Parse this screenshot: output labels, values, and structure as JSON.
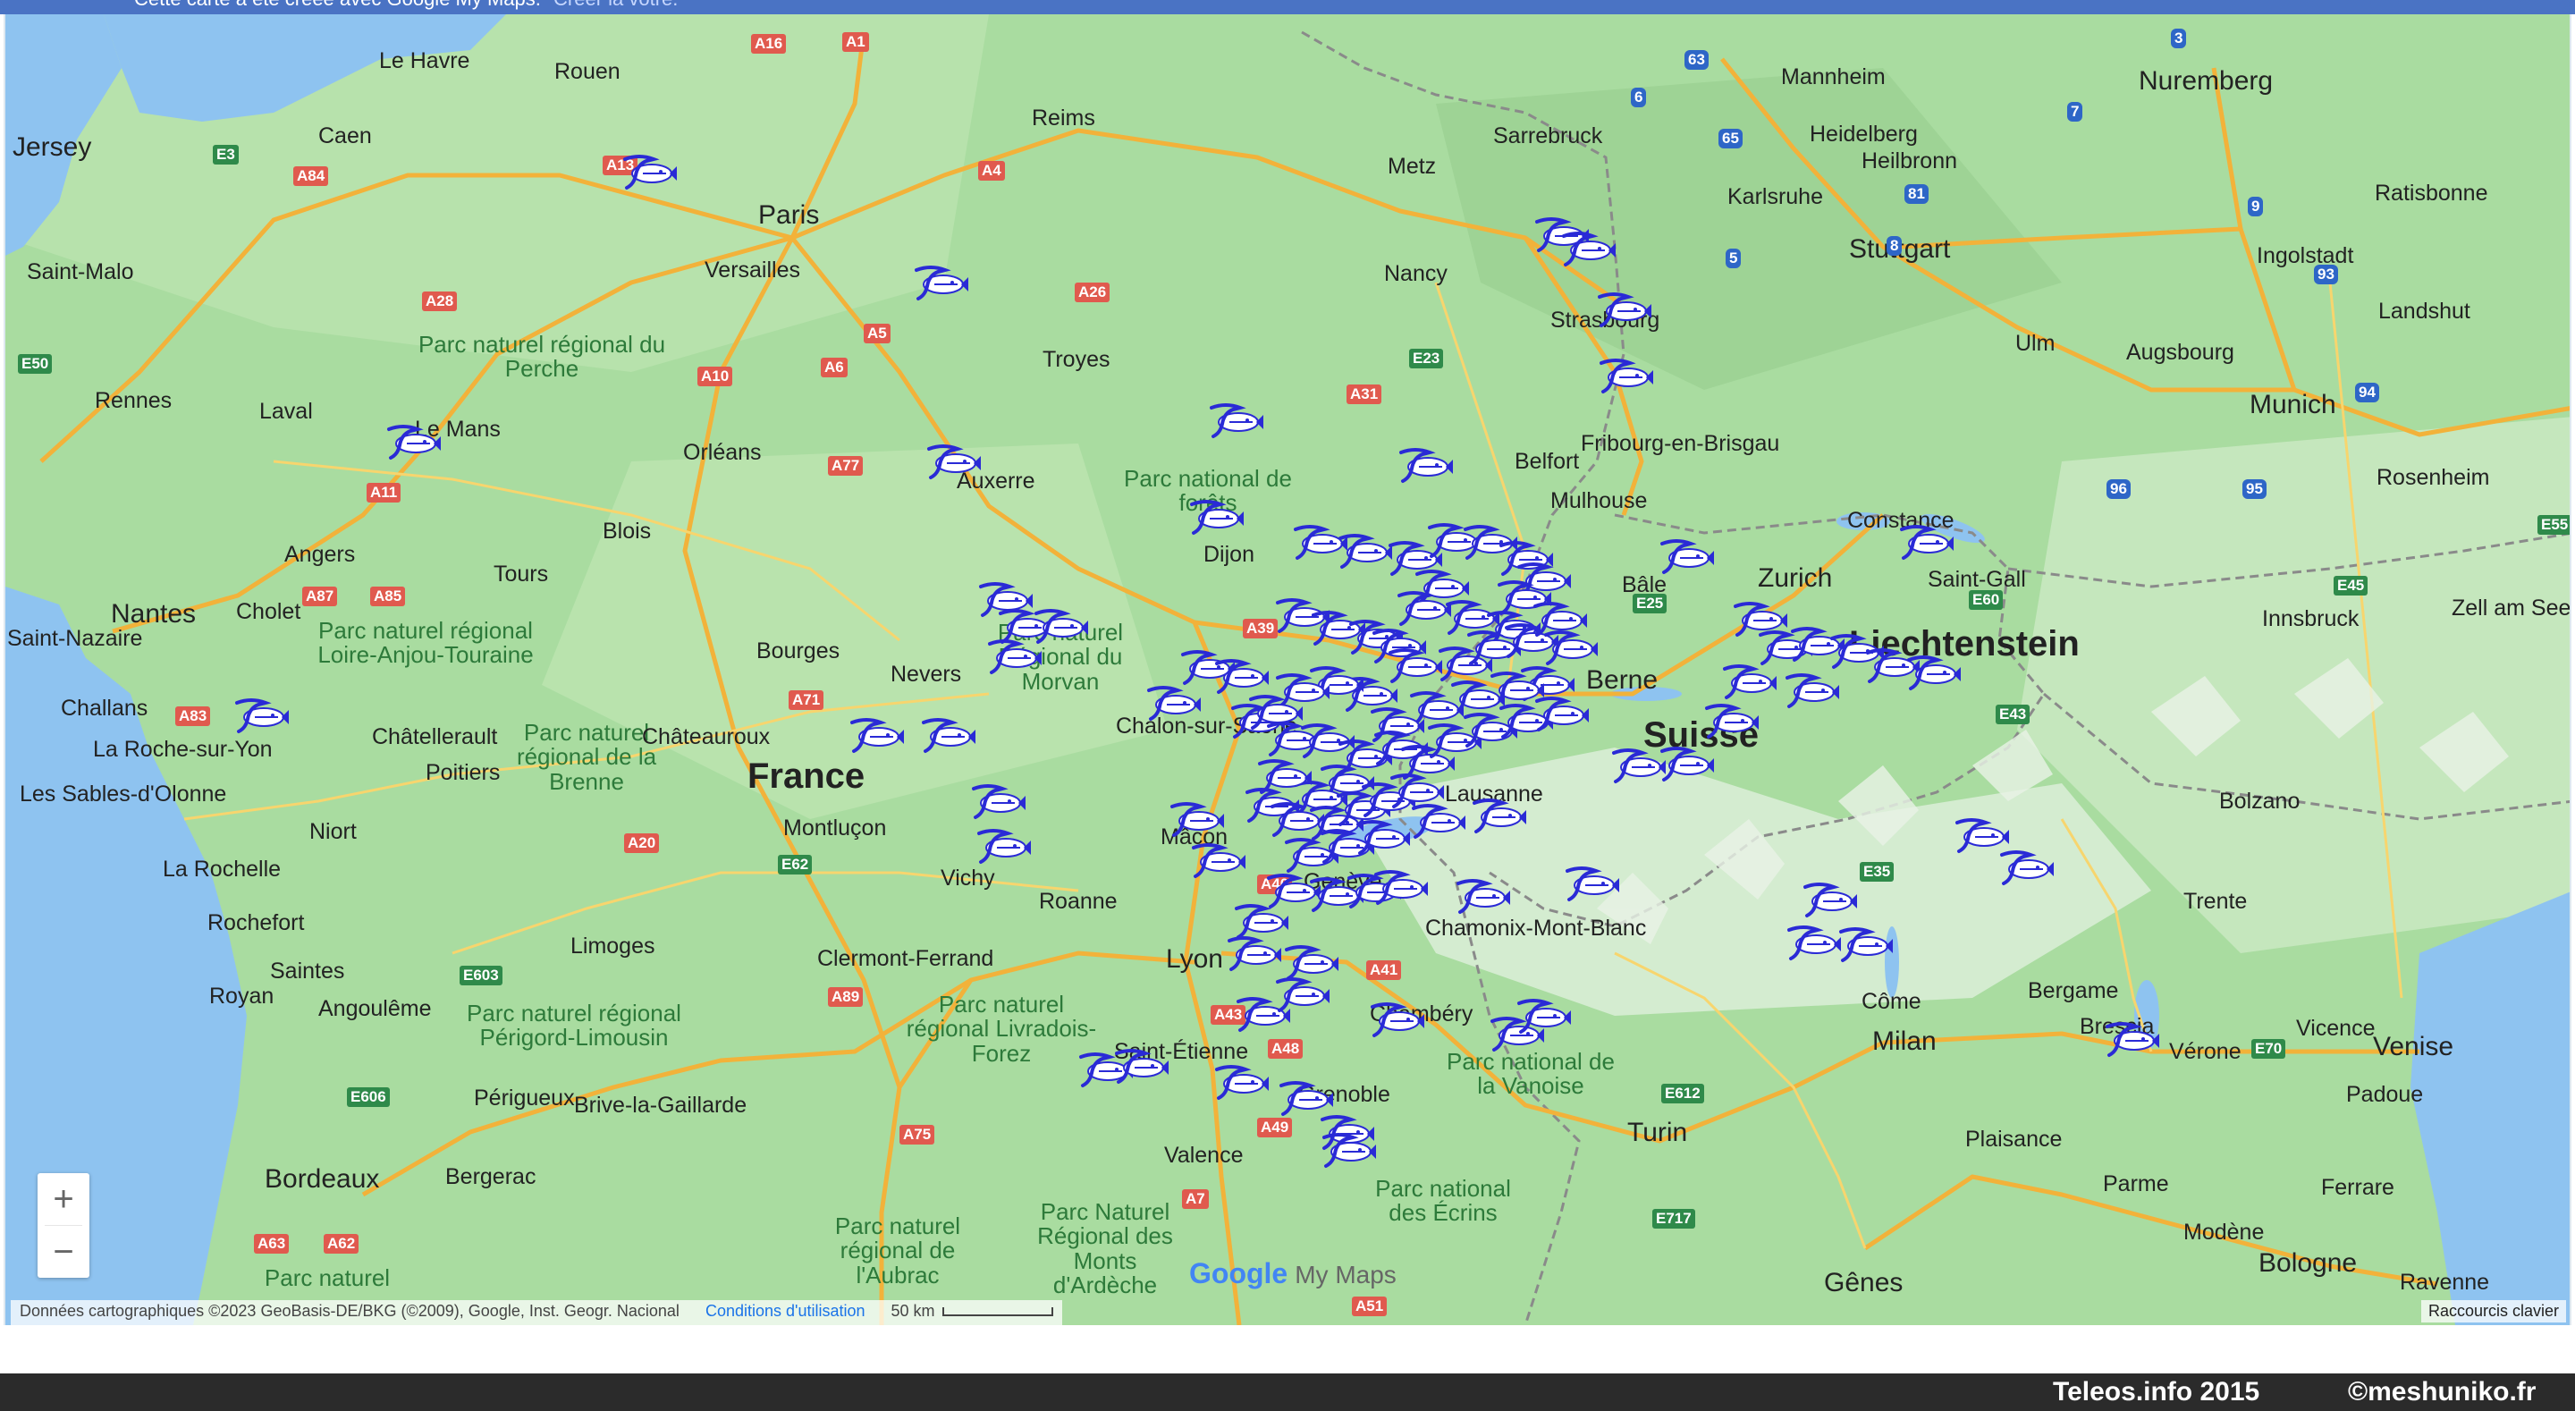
{
  "header": {
    "notice": "Cette carte a été créée avec Google My Maps.",
    "link": "Créer la vôtre."
  },
  "map": {
    "country_labels": [
      "France",
      "Suisse",
      "Liechtenstein"
    ],
    "cities": [
      "Jersey",
      "Le Havre",
      "Rouen",
      "Caen",
      "Reims",
      "Paris",
      "Versailles",
      "Saint-Malo",
      "Rennes",
      "Laval",
      "Le Mans",
      "Troyes",
      "Auxerre",
      "Orléans",
      "Blois",
      "Tours",
      "Angers",
      "Nantes",
      "Cholet",
      "Saint-Nazaire",
      "Challans",
      "La Roche-sur-Yon",
      "Les Sables-d'Olonne",
      "Châtellerault",
      "Poitiers",
      "Niort",
      "La Rochelle",
      "Rochefort",
      "Saintes",
      "Royan",
      "Angoulême",
      "Limoges",
      "Châteauroux",
      "Bourges",
      "Nevers",
      "Montluçon",
      "Vichy",
      "Roanne",
      "Clermont-Ferrand",
      "Dijon",
      "Chalon-sur-Saône",
      "Mâcon",
      "Lyon",
      "Saint-Étienne",
      "Valence",
      "Grenoble",
      "Chambéry",
      "Genève",
      "Lausanne",
      "Berne",
      "Bâle",
      "Zurich",
      "Saint-Gall",
      "Constance",
      "Mulhouse",
      "Fribourg-en-Brisgau",
      "Strasbourg",
      "Nancy",
      "Metz",
      "Sarrebruck",
      "Karlsruhe",
      "Heidelberg",
      "Heilbronn",
      "Mannheim",
      "Stuttgart",
      "Ulm",
      "Augsbourg",
      "Munich",
      "Nuremberg",
      "Ingolstadt",
      "Ratisbonne",
      "Landshut",
      "Rosenheim",
      "Innsbruck",
      "Zell am See",
      "Bolzano",
      "Trente",
      "Bergame",
      "Côme",
      "Milan",
      "Brescia",
      "Vérone",
      "Vicence",
      "Venise",
      "Padoue",
      "Plaisance",
      "Parme",
      "Modène",
      "Bologne",
      "Ferrare",
      "Ravenne",
      "Gênes",
      "Turin",
      "Chamonix-Mont-Blanc",
      "Bordeaux",
      "Bergerac",
      "Périgueux",
      "Brive-la-Gaillarde",
      "Belfort"
    ],
    "parks": [
      "Parc naturel régional du Perche",
      "Parc naturel régional Loire-Anjou-Touraine",
      "Parc naturel régional de la Brenne",
      "Parc naturel Régional du Morvan",
      "Parc naturel régional Livradois-Forez",
      "Parc naturel régional Périgord-Limousin",
      "Parc naturel régional de l'Aubrac",
      "Parc Naturel Régional des Monts d'Ardèche",
      "Parc national de forêts",
      "Parc national de la Vanoise",
      "Parc national des Écrins",
      "Parc naturel"
    ],
    "roads": [
      "A16",
      "A1",
      "A13",
      "A84",
      "A28",
      "A11",
      "A10",
      "A6",
      "A5",
      "A4",
      "A26",
      "A31",
      "E23",
      "A77",
      "A71",
      "A20",
      "A83",
      "A87",
      "A85",
      "A39",
      "A40",
      "A41",
      "A43",
      "A48",
      "A49",
      "A7",
      "A75",
      "A89",
      "A62",
      "A63",
      "A51",
      "E3",
      "E50",
      "E62",
      "E603",
      "E606",
      "E25",
      "E35",
      "E43",
      "E45",
      "E55",
      "E60",
      "E70",
      "E612",
      "E717",
      "3",
      "5",
      "6",
      "7",
      "8",
      "9",
      "63",
      "65",
      "81",
      "93",
      "94",
      "95",
      "96"
    ],
    "marker_icon": "teleos-fish-marker"
  },
  "controls": {
    "zoom_in": "+",
    "zoom_out": "−"
  },
  "attribution": {
    "data": "Données cartographiques ©2023 GeoBasis-DE/BKG (©2009), Google, Inst. Geogr. Nacional",
    "terms": "Conditions d'utilisation",
    "scale": "50 km",
    "keyboard": "Raccourcis clavier",
    "logo_main": "Google",
    "logo_sub": "My Maps"
  },
  "footer": {
    "site": "Teleos.info 2015",
    "author": "©meshuniko.fr"
  },
  "colors": {
    "header": "#4a73c4",
    "land": "#a9dca0",
    "water": "#8ec3f0",
    "footer": "#2b2b2b",
    "marker": "#2a2ad6"
  }
}
